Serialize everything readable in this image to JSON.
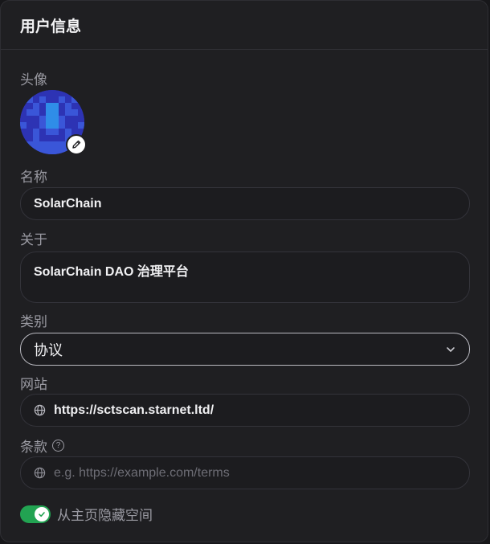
{
  "header": {
    "title": "用户信息"
  },
  "avatar": {
    "label": "头像",
    "colors": {
      "dark": "#2d33b4",
      "mid": "#3a56d8",
      "light": "#2f8de8"
    }
  },
  "name": {
    "label": "名称",
    "value": "SolarChain"
  },
  "about": {
    "label": "关于",
    "value": "SolarChain DAO 治理平台"
  },
  "category": {
    "label": "类别",
    "value": "协议"
  },
  "website": {
    "label": "网站",
    "value": "https://sctscan.starnet.ltd/"
  },
  "terms": {
    "label": "条款",
    "value": "",
    "placeholder": "e.g. https://example.com/terms"
  },
  "toggle": {
    "label": "从主页隐藏空间",
    "checked": true,
    "color": "#22a352"
  }
}
